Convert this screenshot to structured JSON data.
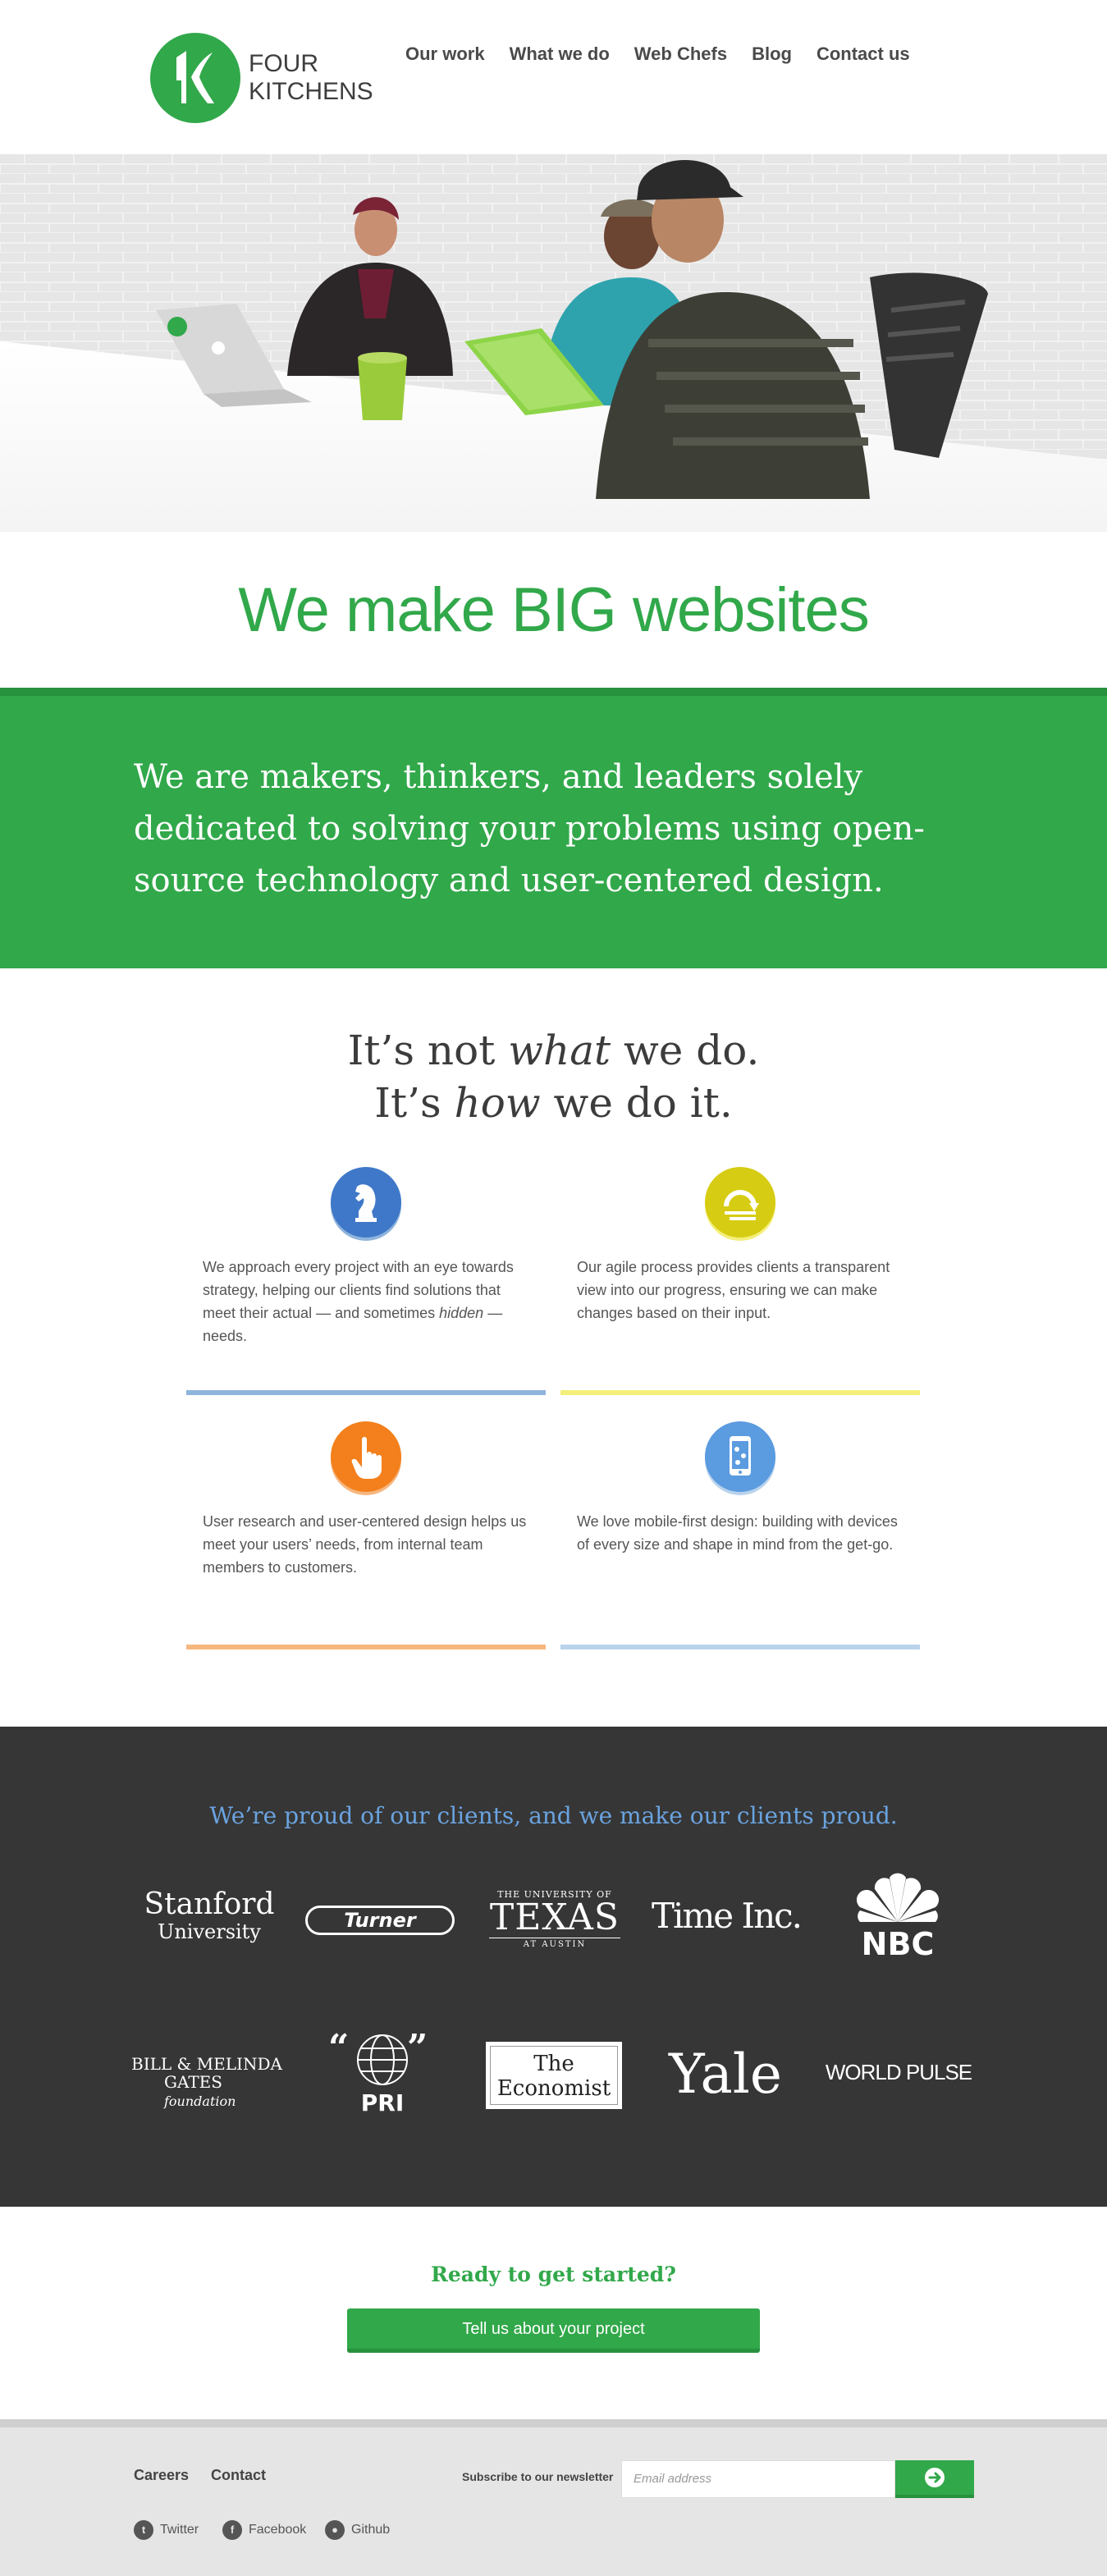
{
  "brand": {
    "line1": "FOUR",
    "line2": "KITCHENS",
    "accent": "#31a84a"
  },
  "nav": [
    {
      "label": "Our work"
    },
    {
      "label": "What we do"
    },
    {
      "label": "Web Chefs"
    },
    {
      "label": "Blog"
    },
    {
      "label": "Contact us"
    }
  ],
  "hero": {
    "headline": "We make BIG websites"
  },
  "band": {
    "text": "We are makers, thinkers, and leaders solely dedicated to solving your problems using open-source technology and user-centered design."
  },
  "how": {
    "line1_a": "It’s not ",
    "line1_em": "what",
    "line1_b": " we do.",
    "line2_a": "It’s ",
    "line2_em": "how",
    "line2_b": " we do it.",
    "features": [
      {
        "icon": "chess-knight-icon",
        "color": "#3f78c8",
        "rule": "#8fb4dc",
        "text_a": "We approach every project with an eye towards strategy, helping our clients find solutions that meet their actual — and sometimes ",
        "text_em": "hidden",
        "text_b": " — needs."
      },
      {
        "icon": "agile-cycle-icon",
        "color": "#d6cc13",
        "rule": "#f4ef7a",
        "text_a": "Our agile process provides clients a transparent view into our progress, ensuring we can make changes based on their input.",
        "text_em": "",
        "text_b": ""
      },
      {
        "icon": "pointer-hand-icon",
        "color": "#f3801c",
        "rule": "#f6b77f",
        "text_a": "User research and user-centered design helps us meet your users’ needs, from internal team members to customers.",
        "text_em": "",
        "text_b": ""
      },
      {
        "icon": "mobile-device-icon",
        "color": "#5b9be0",
        "rule": "#b9d3ec",
        "text_a": "We love mobile-first design: building with devices of every size and shape in mind from the get-go.",
        "text_em": "",
        "text_b": ""
      }
    ]
  },
  "clients": {
    "title": "We’re proud of our clients, and we make our clients proud.",
    "stanford_1": "Stanford",
    "stanford_2": "University",
    "turner": "Turner",
    "texas_top": "THE UNIVERSITY OF",
    "texas_main": "TEXAS",
    "texas_bottom": "AT AUSTIN",
    "timeinc": "Time Inc.",
    "nbc": "NBC",
    "gates_1": "BILL & MELINDA",
    "gates_2": "GATES",
    "gates_3": "foundation",
    "pri": "PRI",
    "economist_1": "The",
    "economist_2": "Economist",
    "yale": "Yale",
    "worldpulse": "WORLD PULSE"
  },
  "cta": {
    "title": "Ready to get started?",
    "button": "Tell us about your project"
  },
  "footer": {
    "careers": "Careers",
    "contact": "Contact",
    "newsletter_label": "Subscribe to our newsletter",
    "email_placeholder": "Email address",
    "twitter": "Twitter",
    "facebook": "Facebook",
    "github": "Github"
  }
}
